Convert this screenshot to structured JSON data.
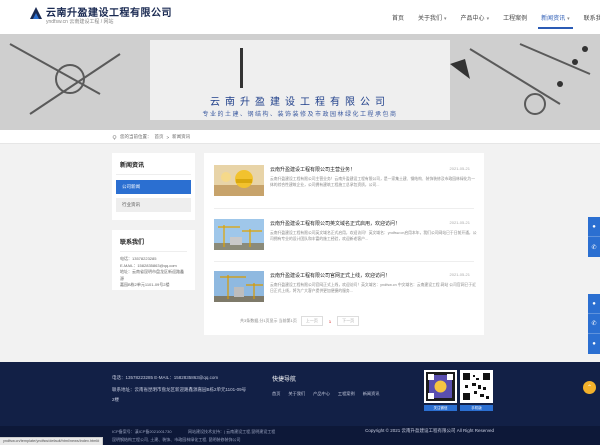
{
  "header": {
    "title": "云南升盈建设工程有限公司",
    "subtitle": "yndfsw.cn 云南建设工程 / 网站",
    "nav": [
      {
        "label": "首页",
        "caret": false,
        "active": false
      },
      {
        "label": "关于我们",
        "caret": true,
        "active": false
      },
      {
        "label": "产品中心",
        "caret": true,
        "active": false
      },
      {
        "label": "工程案例",
        "caret": false,
        "active": false
      },
      {
        "label": "新闻资讯",
        "caret": true,
        "active": true
      },
      {
        "label": "联系我们",
        "caret": false,
        "active": false
      }
    ]
  },
  "banner": {
    "title": "云南升盈建设工程有限公司",
    "slogan": "专业的土建、钢结构、装饰装修及市政园林绿化工程承包商"
  },
  "breadcrumb": {
    "prefix": "您的当前位置：",
    "home": "首页",
    "sep": ">",
    "current": "新闻资讯"
  },
  "sidebar": {
    "heading": "新闻资讯",
    "items": [
      {
        "label": "公司新闻",
        "active": true
      },
      {
        "label": "行业资讯",
        "active": false
      }
    ],
    "contact": {
      "heading": "联系我们",
      "lines": [
        "电话：13578223285",
        "E-MAIL：1582835863@qq.com",
        "地址：云南省昆明市盘龙区新迎路鑫源",
        "嘉园B栋2单元1101-09号2楼"
      ]
    }
  },
  "news": [
    {
      "title": "云南升盈建设工程有限公司主营业务！",
      "date": "2021-05-21",
      "desc": "云南升盈建设工程有限公司主营业务！云南升盈建设工程有限公司，是一家集土建、钢结构、装饰装修及市政园林绿化为一体的综合性建筑企业，公司拥有建筑工程施工总承包资质，公司..."
    },
    {
      "title": "云南升盈建设工程有限公司英文域名正式启用，欢迎访问！",
      "date": "2021-05-21",
      "desc": "云南升盈建设工程有限公司英文域名正式启用，欢迎访问！英文域名：yndfsw.cn启用本年，我们公司网站已于日前开通，公司拥有专业的设计团队和丰富的施工经验，欢迎新老客户..."
    },
    {
      "title": "云南升盈建设工程有限公司官网正式上线，欢迎访问！",
      "date": "2021-05-21",
      "desc": "云南升盈建设工程有限公司官网正式上线，欢迎访问！英文域名：yndfsw.cn 中文域名：云南建设工程.网站 公司官网已于近日正式上线，将为广大客户提供更加便捷的服务..."
    }
  ],
  "pager": {
    "summary": "共3条数据,分1页显示 当前第1页",
    "prev": "上一页",
    "page": "1",
    "next": "下一页"
  },
  "float_icons": [
    "qq-icon",
    "phone-icon"
  ],
  "float_icons2": [
    "qq-icon",
    "phone-icon",
    "qq-icon",
    "phone-icon"
  ],
  "footer": {
    "phone_line": "电话：13578223285    E-MAIL：1582835863@qq.com",
    "addr_line1": "联系地址：云南省昆明市盘龙区新迎路鑫源嘉园B栋2单元1101-09号",
    "addr_line2": "2楼",
    "quick_title": "快捷导航",
    "quick_links": [
      "首页",
      "关于我们",
      "产品中心",
      "工程案例",
      "新闻资讯"
    ],
    "qr1_label": "关注微信",
    "qr2_label": "手机版",
    "icp": "ICP备案号：滇ICP备2021001730",
    "keywords": "网站建设技术支持：|  云南建设工程,昆明建设工程",
    "tags": "昆明钢结构工程公司, 土建、装饰、市政园林绿化工程, 昆明装修装饰公司",
    "copyright": "Copyright © 2021 云南升盈建设工程有限公司 All Right Reserved"
  },
  "status_url": "yndfsw.cn/template/yndfsw/default/html/news/index.html#",
  "colors": {
    "brand": "#2b6fd1",
    "footer": "#122046",
    "accent": "#f2b12b"
  }
}
